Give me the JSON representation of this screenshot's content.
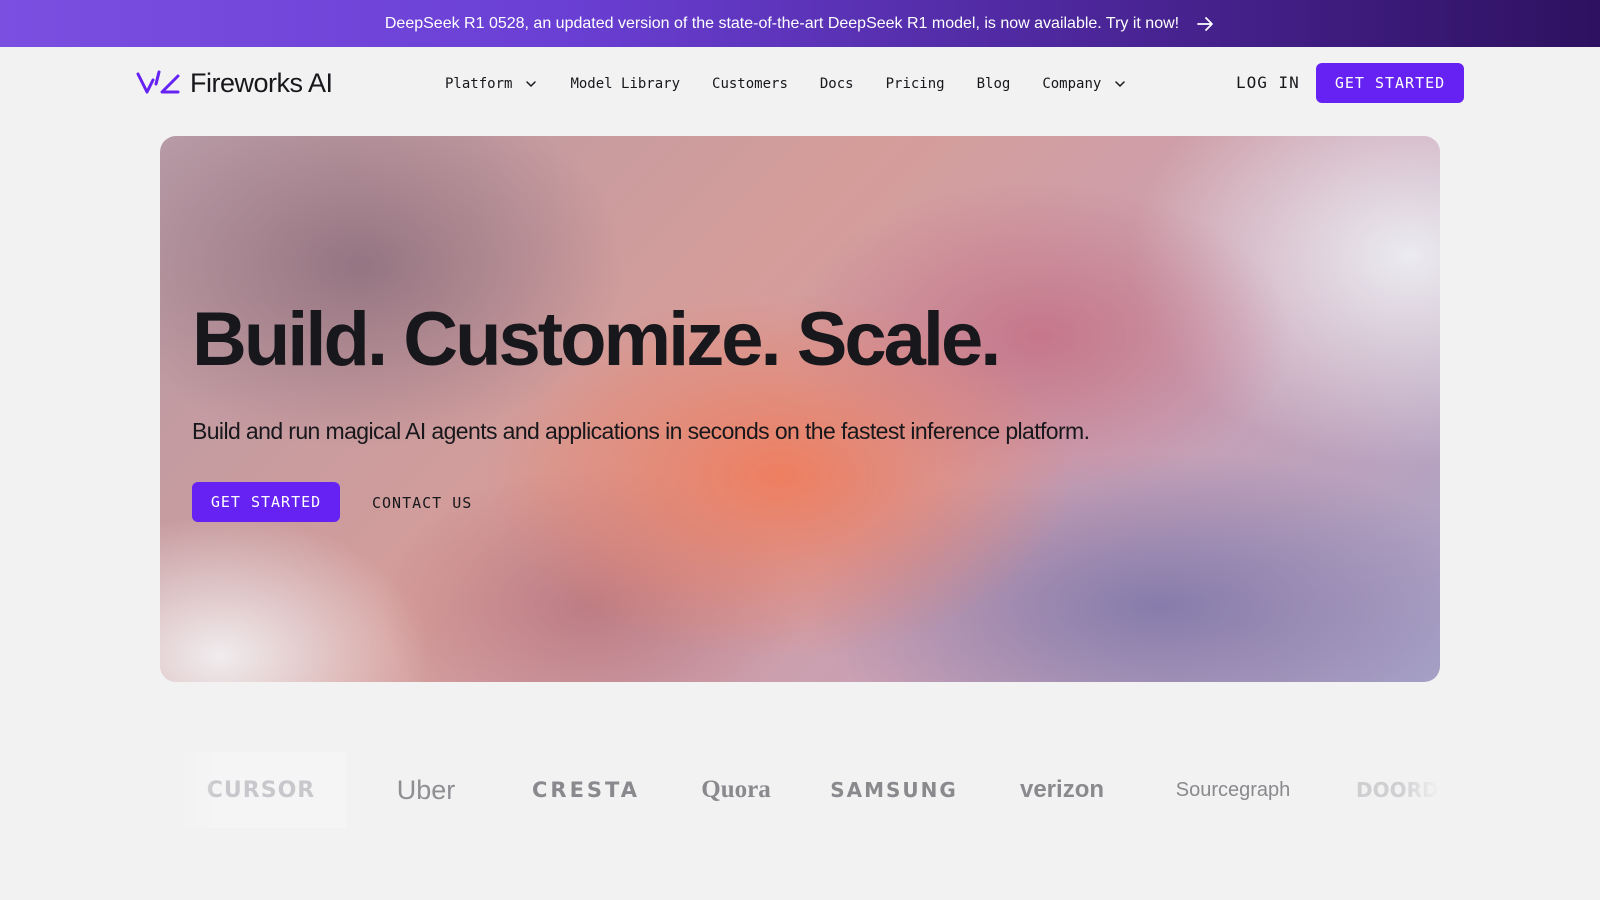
{
  "banner": {
    "text": "DeepSeek R1 0528, an updated version of the state-of-the-art DeepSeek R1 model, is now available. Try it now!",
    "icon": "arrow-right-icon"
  },
  "header": {
    "logo_text": "Fireworks AI",
    "nav": [
      {
        "label": "Platform",
        "has_dropdown": true
      },
      {
        "label": "Model Library",
        "has_dropdown": false
      },
      {
        "label": "Customers",
        "has_dropdown": false
      },
      {
        "label": "Docs",
        "has_dropdown": false
      },
      {
        "label": "Pricing",
        "has_dropdown": false
      },
      {
        "label": "Blog",
        "has_dropdown": false
      },
      {
        "label": "Company",
        "has_dropdown": true
      }
    ],
    "login_label": "LOG IN",
    "cta_label": "GET STARTED"
  },
  "hero": {
    "title": "Build. Customize. Scale.",
    "subtitle": "Build and run magical AI agents and applications in seconds on the fastest inference platform.",
    "cta_label": "GET STARTED",
    "contact_label": "CONTACT US"
  },
  "customers": {
    "logos": [
      "CURSOR",
      "Uber",
      "CRESTA",
      "Quora",
      "SAMSUNG",
      "verizon",
      "Sourcegraph",
      "DOORDASH"
    ]
  },
  "colors": {
    "brand": "#6522f2",
    "background": "#f2f2f2",
    "text": "#17171c"
  }
}
